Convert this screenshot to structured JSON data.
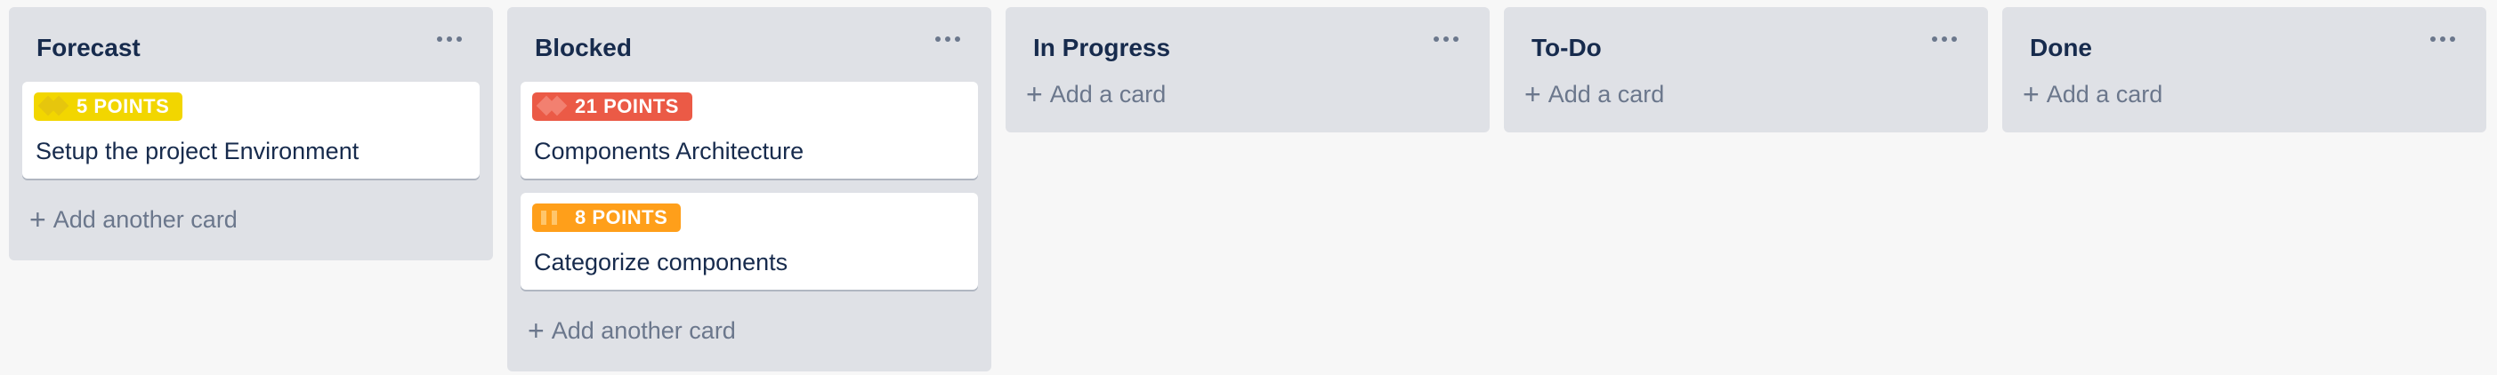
{
  "lists": [
    {
      "title": "Forecast",
      "cards": [
        {
          "points": "5 POINTS",
          "title": "Setup the project Environment",
          "color": "#f2d600",
          "glyph_color": "#e6c60d"
        }
      ],
      "add_label": "Add another card"
    },
    {
      "title": "Blocked",
      "cards": [
        {
          "points": "21 POINTS",
          "title": "Components Architecture",
          "color": "#eb5a46",
          "glyph_color": "#f28070"
        },
        {
          "points": "8 POINTS",
          "title": "Categorize components",
          "color": "#ff9f1a",
          "glyph_color": "#ffc66b"
        }
      ],
      "add_label": "Add another card"
    },
    {
      "title": "In Progress",
      "cards": [],
      "add_label": "Add a card"
    },
    {
      "title": "To-Do",
      "cards": [],
      "add_label": "Add a card"
    },
    {
      "title": "Done",
      "cards": [],
      "add_label": "Add a card"
    }
  ],
  "icons": {
    "more": "more-horizontal-icon",
    "add": "plus-icon"
  }
}
